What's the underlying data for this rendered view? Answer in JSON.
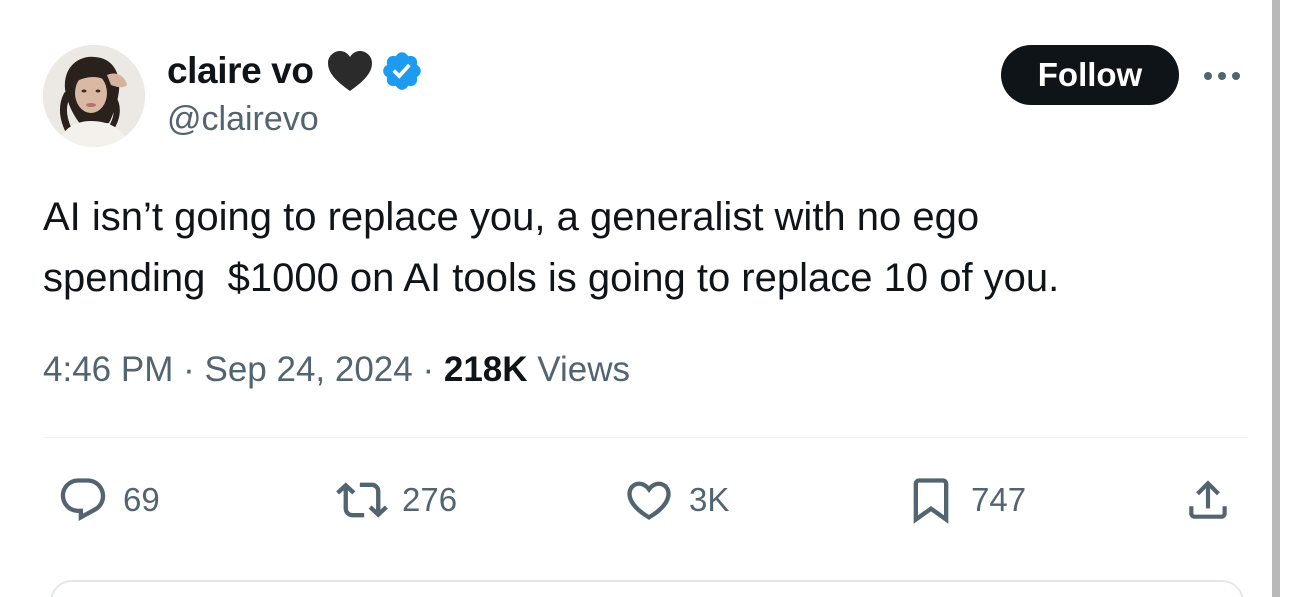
{
  "author": {
    "display_name": "claire vo",
    "handle": "@clairevo",
    "verified": true
  },
  "follow_label": "Follow",
  "tweet": {
    "lines": [
      "AI isn’t going to replace you, a generalist with no ego",
      "spending  $1000 on AI tools is going to replace 10 of you."
    ]
  },
  "meta": {
    "time": "4:46 PM",
    "separator": "·",
    "date": "Sep 24, 2024",
    "views_count": "218K",
    "views_label": "Views"
  },
  "actions": {
    "replies": "69",
    "reposts": "276",
    "likes": "3K",
    "bookmarks": "747"
  },
  "icons": {
    "heart_emoji": "black-heart-icon",
    "verified": "verified-badge-icon",
    "more": "more-dots-icon",
    "reply": "reply-icon",
    "repost": "repost-icon",
    "like": "like-heart-icon",
    "bookmark": "bookmark-icon",
    "share": "share-icon"
  },
  "colors": {
    "text_primary": "#0f1419",
    "text_secondary": "#536471",
    "verified_blue": "#1d9bf0",
    "button_dark": "#0f1419",
    "divider": "#eff3f4"
  }
}
